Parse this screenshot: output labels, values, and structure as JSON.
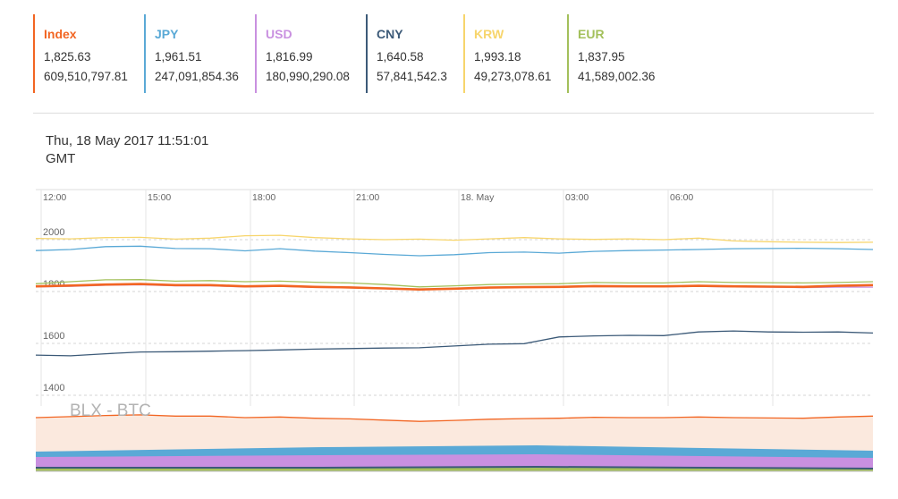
{
  "cards": [
    {
      "name": "Index",
      "price": "1,825.63",
      "volume": "609,510,797.81",
      "color": "#f26522"
    },
    {
      "name": "JPY",
      "price": "1,961.51",
      "volume": "247,091,854.36",
      "color": "#5aa9d6"
    },
    {
      "name": "USD",
      "price": "1,816.99",
      "volume": "180,990,290.08",
      "color": "#c990e0"
    },
    {
      "name": "CNY",
      "price": "1,640.58",
      "volume": "57,841,542.3",
      "color": "#3c5a78"
    },
    {
      "name": "KRW",
      "price": "1,993.18",
      "volume": "49,273,078.61",
      "color": "#f7d56c"
    },
    {
      "name": "EUR",
      "price": "1,837.95",
      "volume": "41,589,002.36",
      "color": "#a3c05b"
    }
  ],
  "timestamp": {
    "line1": "Thu, 18 May 2017 11:51:01",
    "line2": "GMT"
  },
  "chart_data": {
    "type": "line",
    "title": "BLX - BTC",
    "x_ticks": [
      "12:00",
      "15:00",
      "18:00",
      "21:00",
      "18. May",
      "03:00",
      "06:00"
    ],
    "y_ticks": [
      1400,
      1600,
      1800,
      2000
    ],
    "ylim": [
      1300,
      2050
    ],
    "grid": true,
    "x": [
      "11:00",
      "12:00",
      "13:00",
      "14:00",
      "15:00",
      "16:00",
      "17:00",
      "18:00",
      "19:00",
      "20:00",
      "21:00",
      "22:00",
      "23:00",
      "18. May",
      "01:00",
      "02:00",
      "03:00",
      "04:00",
      "05:00",
      "06:00",
      "07:00",
      "08:00",
      "09:00",
      "10:00",
      "11:00"
    ],
    "series": [
      {
        "name": "KRW",
        "color": "#f7d56c",
        "values": [
          2005,
          2003,
          2008,
          2009,
          2002,
          2006,
          2015,
          2017,
          2008,
          2003,
          2000,
          2002,
          1998,
          2003,
          2008,
          2003,
          2001,
          2003,
          2000,
          2006,
          1995,
          1992,
          1990,
          1989,
          1990
        ]
      },
      {
        "name": "JPY",
        "color": "#5aa9d6",
        "values": [
          1958,
          1962,
          1973,
          1975,
          1966,
          1965,
          1957,
          1965,
          1956,
          1950,
          1943,
          1938,
          1942,
          1950,
          1952,
          1948,
          1955,
          1958,
          1960,
          1962,
          1965,
          1966,
          1967,
          1965,
          1962
        ]
      },
      {
        "name": "EUR",
        "color": "#a3c05b",
        "values": [
          1830,
          1838,
          1845,
          1846,
          1840,
          1842,
          1838,
          1840,
          1836,
          1833,
          1827,
          1818,
          1822,
          1827,
          1829,
          1830,
          1835,
          1833,
          1833,
          1838,
          1835,
          1834,
          1833,
          1835,
          1838
        ]
      },
      {
        "name": "USD",
        "color": "#c990e0",
        "values": [
          1818,
          1820,
          1824,
          1826,
          1822,
          1822,
          1818,
          1820,
          1816,
          1814,
          1811,
          1807,
          1810,
          1814,
          1816,
          1817,
          1819,
          1818,
          1818,
          1820,
          1818,
          1817,
          1815,
          1817,
          1817
        ]
      },
      {
        "name": "Index",
        "color": "#f26522",
        "values": [
          1820,
          1823,
          1827,
          1829,
          1825,
          1825,
          1820,
          1822,
          1818,
          1816,
          1812,
          1808,
          1811,
          1815,
          1817,
          1818,
          1821,
          1820,
          1820,
          1822,
          1820,
          1819,
          1818,
          1822,
          1825
        ]
      },
      {
        "name": "CNY",
        "color": "#3c5a78",
        "values": [
          1555,
          1552,
          1560,
          1567,
          1568,
          1570,
          1572,
          1575,
          1578,
          1580,
          1582,
          1583,
          1590,
          1597,
          1599,
          1625,
          1629,
          1631,
          1630,
          1644,
          1648,
          1644,
          1643,
          1644,
          1640
        ]
      }
    ],
    "navigator": {
      "label": "BLX - BTC"
    }
  }
}
